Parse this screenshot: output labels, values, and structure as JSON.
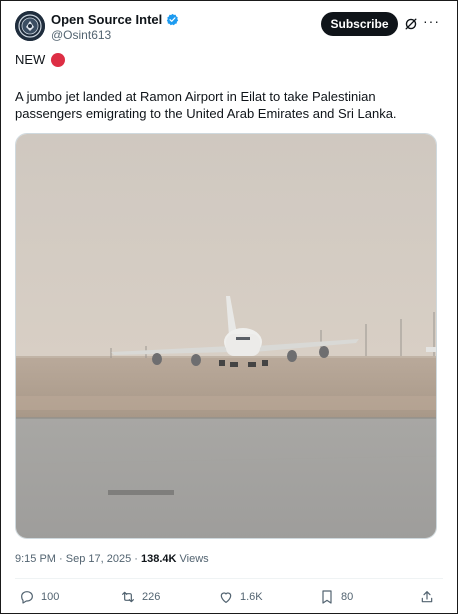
{
  "author": {
    "name": "Open Source Intel",
    "handle": "@Osint613"
  },
  "header": {
    "subscribe_label": "Subscribe",
    "more_label": "···"
  },
  "post": {
    "tag": "NEW",
    "text": "A jumbo jet landed at Ramon Airport in Eilat to take Palestinian passengers emigrating to the United Arab Emirates and Sri Lanka.",
    "timestamp": "9:15 PM · Sep 17, 2025 · ",
    "views_count": "138.4K",
    "views_label": " Views"
  },
  "actions": {
    "replies": "100",
    "reposts": "226",
    "likes": "1.6K",
    "bookmarks": "80"
  },
  "colors": {
    "verified": "#1d9bf0",
    "red_dot": "#dd2e44",
    "subscribe_bg": "#0f1419"
  },
  "icons": [
    "verified-badge-icon",
    "grok-icon",
    "reply-icon",
    "repost-icon",
    "like-icon",
    "bookmark-icon",
    "share-icon"
  ]
}
